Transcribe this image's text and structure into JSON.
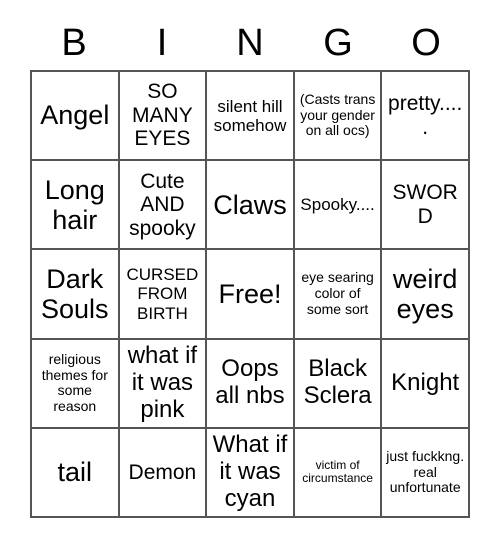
{
  "card": {
    "header_letters": [
      "B",
      "I",
      "N",
      "G",
      "O"
    ],
    "rows": [
      [
        {
          "text": "Angel",
          "size": "fs-xxl"
        },
        {
          "text": "SO MANY EYES",
          "size": "fs-lg"
        },
        {
          "text": "silent hill somehow",
          "size": "fs-md"
        },
        {
          "text": "(Casts trans your gender on all ocs)",
          "size": "fs-sm"
        },
        {
          "text": "pretty.....",
          "size": "fs-lg"
        }
      ],
      [
        {
          "text": "Long hair",
          "size": "fs-xxl"
        },
        {
          "text": "Cute AND spooky",
          "size": "fs-lg"
        },
        {
          "text": "Claws",
          "size": "fs-xxl"
        },
        {
          "text": "Spooky....",
          "size": "fs-md"
        },
        {
          "text": "SWORD",
          "size": "fs-lg"
        }
      ],
      [
        {
          "text": "Dark Souls",
          "size": "fs-xxl"
        },
        {
          "text": "CURSED FROM BIRTH",
          "size": "fs-md"
        },
        {
          "text": "Free!",
          "size": "fs-xxl"
        },
        {
          "text": "eye searing color of some sort",
          "size": "fs-sm"
        },
        {
          "text": "weird eyes",
          "size": "fs-xxl"
        }
      ],
      [
        {
          "text": "religious themes for some reason",
          "size": "fs-sm"
        },
        {
          "text": "what if it was pink",
          "size": "fs-xl"
        },
        {
          "text": "Oops all nbs",
          "size": "fs-xl"
        },
        {
          "text": "Black Sclera",
          "size": "fs-xl"
        },
        {
          "text": "Knight",
          "size": "fs-xl"
        }
      ],
      [
        {
          "text": "tail",
          "size": "fs-xxl"
        },
        {
          "text": "Demon",
          "size": "fs-lg"
        },
        {
          "text": "What if it was cyan",
          "size": "fs-xl"
        },
        {
          "text": "victim of circumstance",
          "size": "fs-xs"
        },
        {
          "text": "just fuckkng. real unfortunate",
          "size": "fs-sm"
        }
      ]
    ]
  },
  "colors": {
    "background": "#ffffff",
    "text": "#000000",
    "grid_line": "#555555"
  }
}
